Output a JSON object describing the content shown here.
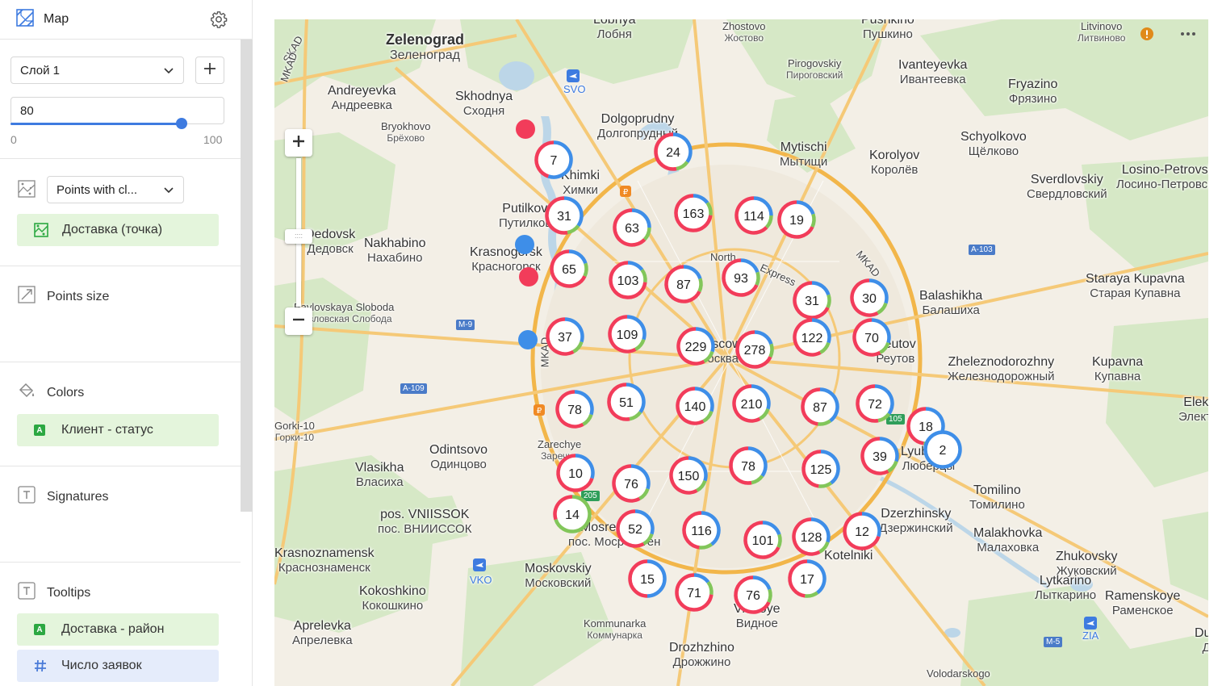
{
  "sidebar": {
    "title": "Map",
    "layer_select": "Слой 1",
    "opacity_value": "80",
    "opacity_level": 0.8,
    "opacity_min": "0",
    "opacity_max": "100",
    "viz_type_select": "Points with cl...",
    "geo_field": "Доставка (точка)",
    "points_size_label": "Points size",
    "colors_label": "Colors",
    "colors_field": "Клиент - статус",
    "signatures_label": "Signatures",
    "tooltips_label": "Tooltips",
    "tooltip_fields": [
      "Доставка - район",
      "Число заявок"
    ],
    "badge_letter": "A",
    "colors": {
      "accent": "#3e7be0",
      "chip_green": "#e4f5dc",
      "chip_blue": "#e5ecfb"
    }
  },
  "map": {
    "place_labels": [
      {
        "lat": "Zelenograd",
        "cyr": "Зеленоград"
      },
      {
        "lat": "Lobnya",
        "cyr": "Лобня"
      },
      {
        "lat": "Zhostovo",
        "cyr": "Жостово"
      },
      {
        "lat": "Pushkino",
        "cyr": "Пушкино"
      },
      {
        "lat": "Litvinovo",
        "cyr": "Литвиново"
      },
      {
        "lat": "Andreyevka",
        "cyr": "Андреевка"
      },
      {
        "lat": "Skhodnya",
        "cyr": "Сходня"
      },
      {
        "lat": "Pirogovskiy",
        "cyr": "Пироговский"
      },
      {
        "lat": "Ivanteyevka",
        "cyr": "Ивантеевка"
      },
      {
        "lat": "Fryazino",
        "cyr": "Фрязино"
      },
      {
        "lat": "Bryokhovo",
        "cyr": "Брёхово"
      },
      {
        "lat": "Dolgoprudny",
        "cyr": "Долгопрудный"
      },
      {
        "lat": "Mytischi",
        "cyr": "Мытищи"
      },
      {
        "lat": "Korolyov",
        "cyr": "Королёв"
      },
      {
        "lat": "Schyolkovo",
        "cyr": "Щёлково"
      },
      {
        "lat": "Khimki",
        "cyr": "Химки"
      },
      {
        "lat": "Sverdlovskiy",
        "cyr": "Свердловский"
      },
      {
        "lat": "Losino-Petrovsky",
        "cyr": "Лосино-Петровский"
      },
      {
        "lat": "Putilkovo",
        "cyr": "Путилково"
      },
      {
        "lat": "Dedovsk",
        "cyr": "Дедовск"
      },
      {
        "lat": "Nakhabino",
        "cyr": "Нахабино"
      },
      {
        "lat": "Krasnogorsk",
        "cyr": "Красногорск"
      },
      {
        "lat": "Staraya Kupavna",
        "cyr": "Старая Купавна"
      },
      {
        "lat": "Balashikha",
        "cyr": "Балашиха"
      },
      {
        "lat": "Pavlovskaya Sloboda",
        "cyr": "Павловская Слобода"
      },
      {
        "lat": "Reutov",
        "cyr": "Реутов"
      },
      {
        "lat": "Zheleznodorozhny",
        "cyr": "Железнодорожный"
      },
      {
        "lat": "Kupavna",
        "cyr": "Купавна"
      },
      {
        "lat": "Moscow",
        "cyr": "Москва"
      },
      {
        "lat": "Elektrougli",
        "cyr": "Электроугли"
      },
      {
        "lat": "Gorki-10",
        "cyr": "Горки-10"
      },
      {
        "lat": "Zarechye",
        "cyr": "Заречье"
      },
      {
        "lat": "Odintsovo",
        "cyr": "Одинцово"
      },
      {
        "lat": "Vlasikha",
        "cyr": "Власиха"
      },
      {
        "lat": "Lyubertsy",
        "cyr": "Люберцы"
      },
      {
        "lat": "Tomilino",
        "cyr": "Томилино"
      },
      {
        "lat": "pos. VNIISSOK",
        "cyr": "пос. ВНИИССОК"
      },
      {
        "lat": "Dzerzhinsky",
        "cyr": "Дзержинский"
      },
      {
        "lat": "Mosrentgen",
        "cyr": "пос. Мосрентген"
      },
      {
        "lat": "Malakhovka",
        "cyr": "Малаховка"
      },
      {
        "lat": "Krasnoznamensk",
        "cyr": "Краснознаменск"
      },
      {
        "lat": "Zhukovsky",
        "cyr": "Жуковский"
      },
      {
        "lat": "Vidnoye",
        "cyr": "Видное"
      },
      {
        "lat": "Moskovskiy",
        "cyr": "Московский"
      },
      {
        "lat": "Kokoshkino",
        "cyr": "Кокошкино"
      },
      {
        "lat": "Lytkarino",
        "cyr": "Лыткарино"
      },
      {
        "lat": "Ramenskoye",
        "cyr": "Раменское"
      },
      {
        "lat": "Aprelevka",
        "cyr": "Апрелевка"
      },
      {
        "lat": "Kommunarka",
        "cyr": "Коммунарка"
      },
      {
        "lat": "Drozhzhino",
        "cyr": "Дрожжино"
      },
      {
        "lat": "Volodarskogo",
        "cyr": ""
      },
      {
        "lat": "Dub",
        "cyr": "Д"
      },
      {
        "lat": "Kotelniki",
        "cyr": ""
      }
    ],
    "road_badges": [
      "A-103",
      "M-9",
      "A-109",
      "M-5",
      "105",
      "205"
    ],
    "airport_labels": [
      "SVO",
      "VKO",
      "ZIA"
    ],
    "road_names": [
      "MKAD",
      "SKAD",
      "North",
      "Express",
      "MKAD",
      "MKAD"
    ],
    "clusters": [
      {
        "n": "7",
        "parts": [
          0.55,
          0.45
        ]
      },
      {
        "n": "24",
        "parts": [
          0.35,
          0.65
        ]
      },
      {
        "n": "31",
        "parts": [
          0.35,
          0.65
        ]
      },
      {
        "n": "63",
        "parts": [
          0.25,
          0.75
        ]
      },
      {
        "n": "163",
        "parts": [
          0.15,
          0.85
        ]
      },
      {
        "n": "114",
        "parts": [
          0.25,
          0.75
        ]
      },
      {
        "n": "19",
        "parts": [
          0.2,
          0.8
        ]
      },
      {
        "n": "65",
        "parts": [
          0.2,
          0.8
        ]
      },
      {
        "n": "103",
        "parts": [
          0.15,
          0.85
        ]
      },
      {
        "n": "87",
        "parts": [
          0.2,
          0.8
        ]
      },
      {
        "n": "93",
        "parts": [
          0.2,
          0.8
        ]
      },
      {
        "n": "31",
        "parts": [
          0.2,
          0.8
        ]
      },
      {
        "n": "30",
        "parts": [
          0.3,
          0.7
        ]
      },
      {
        "n": "37",
        "parts": [
          0.3,
          0.7
        ]
      },
      {
        "n": "109",
        "parts": [
          0.3,
          0.7
        ]
      },
      {
        "n": "229",
        "parts": [
          0.3,
          0.7
        ]
      },
      {
        "n": "278",
        "parts": [
          0.2,
          0.8
        ]
      },
      {
        "n": "122",
        "parts": [
          0.3,
          0.7
        ]
      },
      {
        "n": "70",
        "parts": [
          0.3,
          0.7
        ]
      },
      {
        "n": "78",
        "parts": [
          0.3,
          0.7
        ]
      },
      {
        "n": "51",
        "parts": [
          0.35,
          0.65
        ]
      },
      {
        "n": "140",
        "parts": [
          0.3,
          0.7
        ]
      },
      {
        "n": "210",
        "parts": [
          0.3,
          0.7
        ]
      },
      {
        "n": "87",
        "parts": [
          0.4,
          0.6
        ]
      },
      {
        "n": "72",
        "parts": [
          0.35,
          0.65
        ]
      },
      {
        "n": "18",
        "parts": [
          0.4,
          0.6
        ]
      },
      {
        "n": "2",
        "parts": [
          1.0,
          0.0
        ]
      },
      {
        "n": "39",
        "parts": [
          0.3,
          0.7
        ]
      },
      {
        "n": "10",
        "parts": [
          0.3,
          0.7
        ]
      },
      {
        "n": "76",
        "parts": [
          0.3,
          0.7
        ]
      },
      {
        "n": "150",
        "parts": [
          0.3,
          0.7
        ]
      },
      {
        "n": "78",
        "parts": [
          0.35,
          0.65
        ]
      },
      {
        "n": "125",
        "parts": [
          0.4,
          0.6
        ]
      },
      {
        "n": "14",
        "parts": [
          0.0,
          1.0
        ]
      },
      {
        "n": "52",
        "parts": [
          0.3,
          0.7
        ]
      },
      {
        "n": "116",
        "parts": [
          0.4,
          0.6
        ]
      },
      {
        "n": "101",
        "parts": [
          0.2,
          0.8
        ]
      },
      {
        "n": "128",
        "parts": [
          0.3,
          0.7
        ]
      },
      {
        "n": "12",
        "parts": [
          0.3,
          0.7
        ]
      },
      {
        "n": "15",
        "parts": [
          0.5,
          0.5
        ]
      },
      {
        "n": "71",
        "parts": [
          0.15,
          0.85
        ]
      },
      {
        "n": "76",
        "parts": [
          0.2,
          0.8
        ]
      },
      {
        "n": "17",
        "parts": [
          0.4,
          0.6
        ]
      }
    ],
    "single_points": [
      {
        "status": "red"
      },
      {
        "status": "blue"
      },
      {
        "status": "red"
      },
      {
        "status": "blue"
      }
    ],
    "colors": {
      "blue": "#3e8ee8",
      "red": "#f23c5a",
      "green": "#82c65a",
      "water": "#bcd6e8",
      "green_area": "#d5e8c4",
      "road_main": "#f5c977",
      "road_ring": "#f2b64a"
    }
  }
}
